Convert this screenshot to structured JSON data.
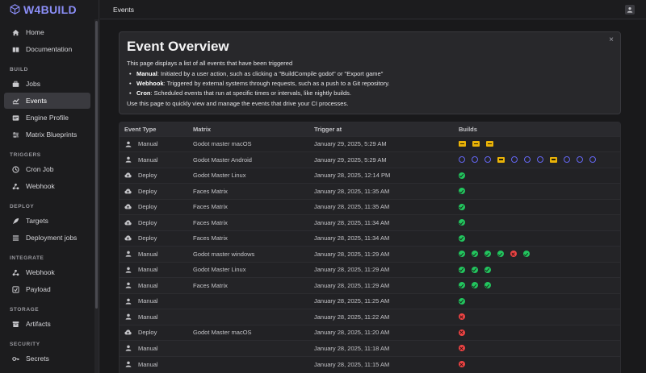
{
  "app": {
    "logo": "W4BUILD",
    "page_title": "Events"
  },
  "sidebar": {
    "top": [
      {
        "label": "Home",
        "icon": "home-icon"
      },
      {
        "label": "Documentation",
        "icon": "book-icon"
      }
    ],
    "sections": [
      {
        "title": "BUILD",
        "items": [
          {
            "label": "Jobs",
            "icon": "briefcase-icon"
          },
          {
            "label": "Events",
            "icon": "events-icon",
            "active": true
          },
          {
            "label": "Engine Profile",
            "icon": "profile-icon"
          },
          {
            "label": "Matrix Blueprints",
            "icon": "sliders-icon"
          }
        ]
      },
      {
        "title": "TRIGGERS",
        "items": [
          {
            "label": "Cron Job",
            "icon": "clock-icon"
          },
          {
            "label": "Webhook",
            "icon": "webhook-icon"
          }
        ]
      },
      {
        "title": "DEPLOY",
        "items": [
          {
            "label": "Targets",
            "icon": "rocket-icon"
          },
          {
            "label": "Deployment jobs",
            "icon": "list-icon"
          }
        ]
      },
      {
        "title": "INTEGRATE",
        "items": [
          {
            "label": "Webhook",
            "icon": "webhook-icon"
          },
          {
            "label": "Payload",
            "icon": "payload-icon"
          }
        ]
      },
      {
        "title": "STORAGE",
        "items": [
          {
            "label": "Artifacts",
            "icon": "archive-icon"
          }
        ]
      },
      {
        "title": "SECURITY",
        "items": [
          {
            "label": "Secrets",
            "icon": "key-icon"
          }
        ]
      }
    ]
  },
  "overview": {
    "title": "Event Overview",
    "intro": "This page displays a list of all events that have been triggered",
    "bullets": [
      {
        "term": "Manual",
        "text": ": Initiated by a user action, such as clicking a \"BuildCompile godot\" or \"Export game\""
      },
      {
        "term": "Webhook",
        "text": ": Triggered by external systems through requests, such as a push to a Git repository."
      },
      {
        "term": "Cron",
        "text": ": Scheduled events that run at specific times or intervals, like nightly builds."
      }
    ],
    "outro": "Use this page to quickly view and manage the events that drive your CI processes.",
    "close": "×"
  },
  "table": {
    "headers": [
      "Event Type",
      "Matrix",
      "Trigger at",
      "Builds"
    ],
    "rows": [
      {
        "type": "Manual",
        "matrix": "Godot master macOS",
        "trigger": "January 29, 2025, 5:29 AM",
        "builds": [
          "run",
          "run",
          "run"
        ]
      },
      {
        "type": "Manual",
        "matrix": "Godot Master Android",
        "trigger": "January 29, 2025, 5:29 AM",
        "builds": [
          "pend",
          "pend",
          "pend",
          "run",
          "pend",
          "pend",
          "pend",
          "run",
          "pend",
          "pend",
          "pend"
        ]
      },
      {
        "type": "Deploy",
        "matrix": "Godot Master Linux",
        "trigger": "January 28, 2025, 12:14 PM",
        "builds": [
          "ok"
        ]
      },
      {
        "type": "Deploy",
        "matrix": "Faces Matrix",
        "trigger": "January 28, 2025, 11:35 AM",
        "builds": [
          "ok"
        ]
      },
      {
        "type": "Deploy",
        "matrix": "Faces Matrix",
        "trigger": "January 28, 2025, 11:35 AM",
        "builds": [
          "ok"
        ]
      },
      {
        "type": "Deploy",
        "matrix": "Faces Matrix",
        "trigger": "January 28, 2025, 11:34 AM",
        "builds": [
          "ok"
        ]
      },
      {
        "type": "Deploy",
        "matrix": "Faces Matrix",
        "trigger": "January 28, 2025, 11:34 AM",
        "builds": [
          "ok"
        ]
      },
      {
        "type": "Manual",
        "matrix": "Godot master windows",
        "trigger": "January 28, 2025, 11:29 AM",
        "builds": [
          "ok",
          "ok",
          "ok",
          "ok",
          "fail",
          "ok"
        ]
      },
      {
        "type": "Manual",
        "matrix": "Godot Master Linux",
        "trigger": "January 28, 2025, 11:29 AM",
        "builds": [
          "ok",
          "ok",
          "ok"
        ]
      },
      {
        "type": "Manual",
        "matrix": "Faces Matrix",
        "trigger": "January 28, 2025, 11:29 AM",
        "builds": [
          "ok",
          "ok",
          "ok"
        ]
      },
      {
        "type": "Manual",
        "matrix": "",
        "trigger": "January 28, 2025, 11:25 AM",
        "builds": [
          "ok"
        ]
      },
      {
        "type": "Manual",
        "matrix": "",
        "trigger": "January 28, 2025, 11:22 AM",
        "builds": [
          "fail"
        ]
      },
      {
        "type": "Deploy",
        "matrix": "Godot Master macOS",
        "trigger": "January 28, 2025, 11:20 AM",
        "builds": [
          "fail"
        ]
      },
      {
        "type": "Manual",
        "matrix": "",
        "trigger": "January 28, 2025, 11:18 AM",
        "builds": [
          "fail"
        ]
      },
      {
        "type": "Manual",
        "matrix": "",
        "trigger": "January 28, 2025, 11:15 AM",
        "builds": [
          "fail"
        ]
      }
    ]
  }
}
